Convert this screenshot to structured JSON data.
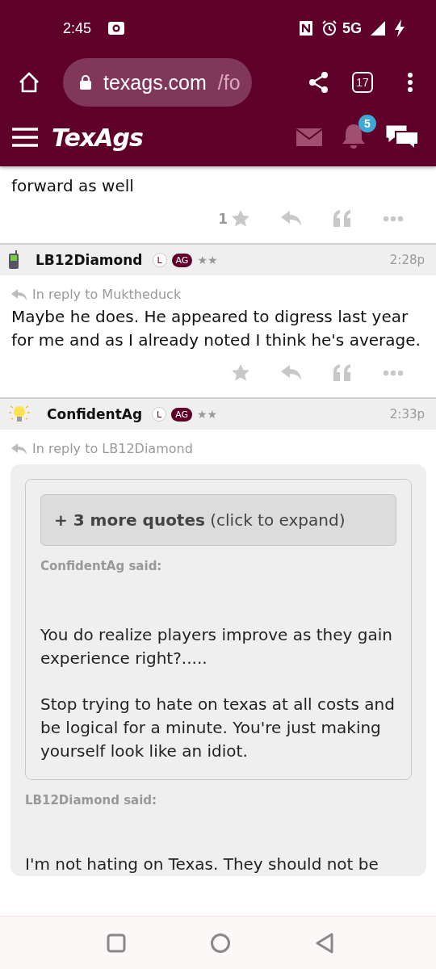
{
  "status_bar": {
    "time": "2:45",
    "network": "5G"
  },
  "browser": {
    "url_host": "texags.com",
    "url_path": "/fo",
    "tab_count": "17"
  },
  "site_header": {
    "logo": "TexAgs",
    "notification_count": "5"
  },
  "posts": [
    {
      "kind": "fragment",
      "body": "forward as well",
      "likes": "1"
    },
    {
      "kind": "post",
      "author": "LB12Diamond",
      "badges": [
        "L",
        "AG"
      ],
      "rank": "★★",
      "time": "2:28p",
      "reply_to": "In reply to Muktheduck",
      "body": "Maybe he does. He appeared to digress last year for me and as I already noted I think he's average."
    },
    {
      "kind": "quoted",
      "author": "ConfidentAg",
      "badges": [
        "L",
        "AG"
      ],
      "rank": "★★",
      "time": "2:33p",
      "reply_to": "In reply to LB12Diamond",
      "quote": {
        "more": "+ 3 more quotes",
        "more_hint": "(click to expand)",
        "said": "ConfidentAg said:",
        "paragraphs": [
          "You do realize players improve as they gain experience right?.....",
          "Stop trying to hate on texas at all costs and be logical for a minute. You're just making yourself look like an idiot."
        ]
      },
      "said": "LB12Diamond said:",
      "body": "I'm not hating on Texas. They should not be"
    }
  ]
}
